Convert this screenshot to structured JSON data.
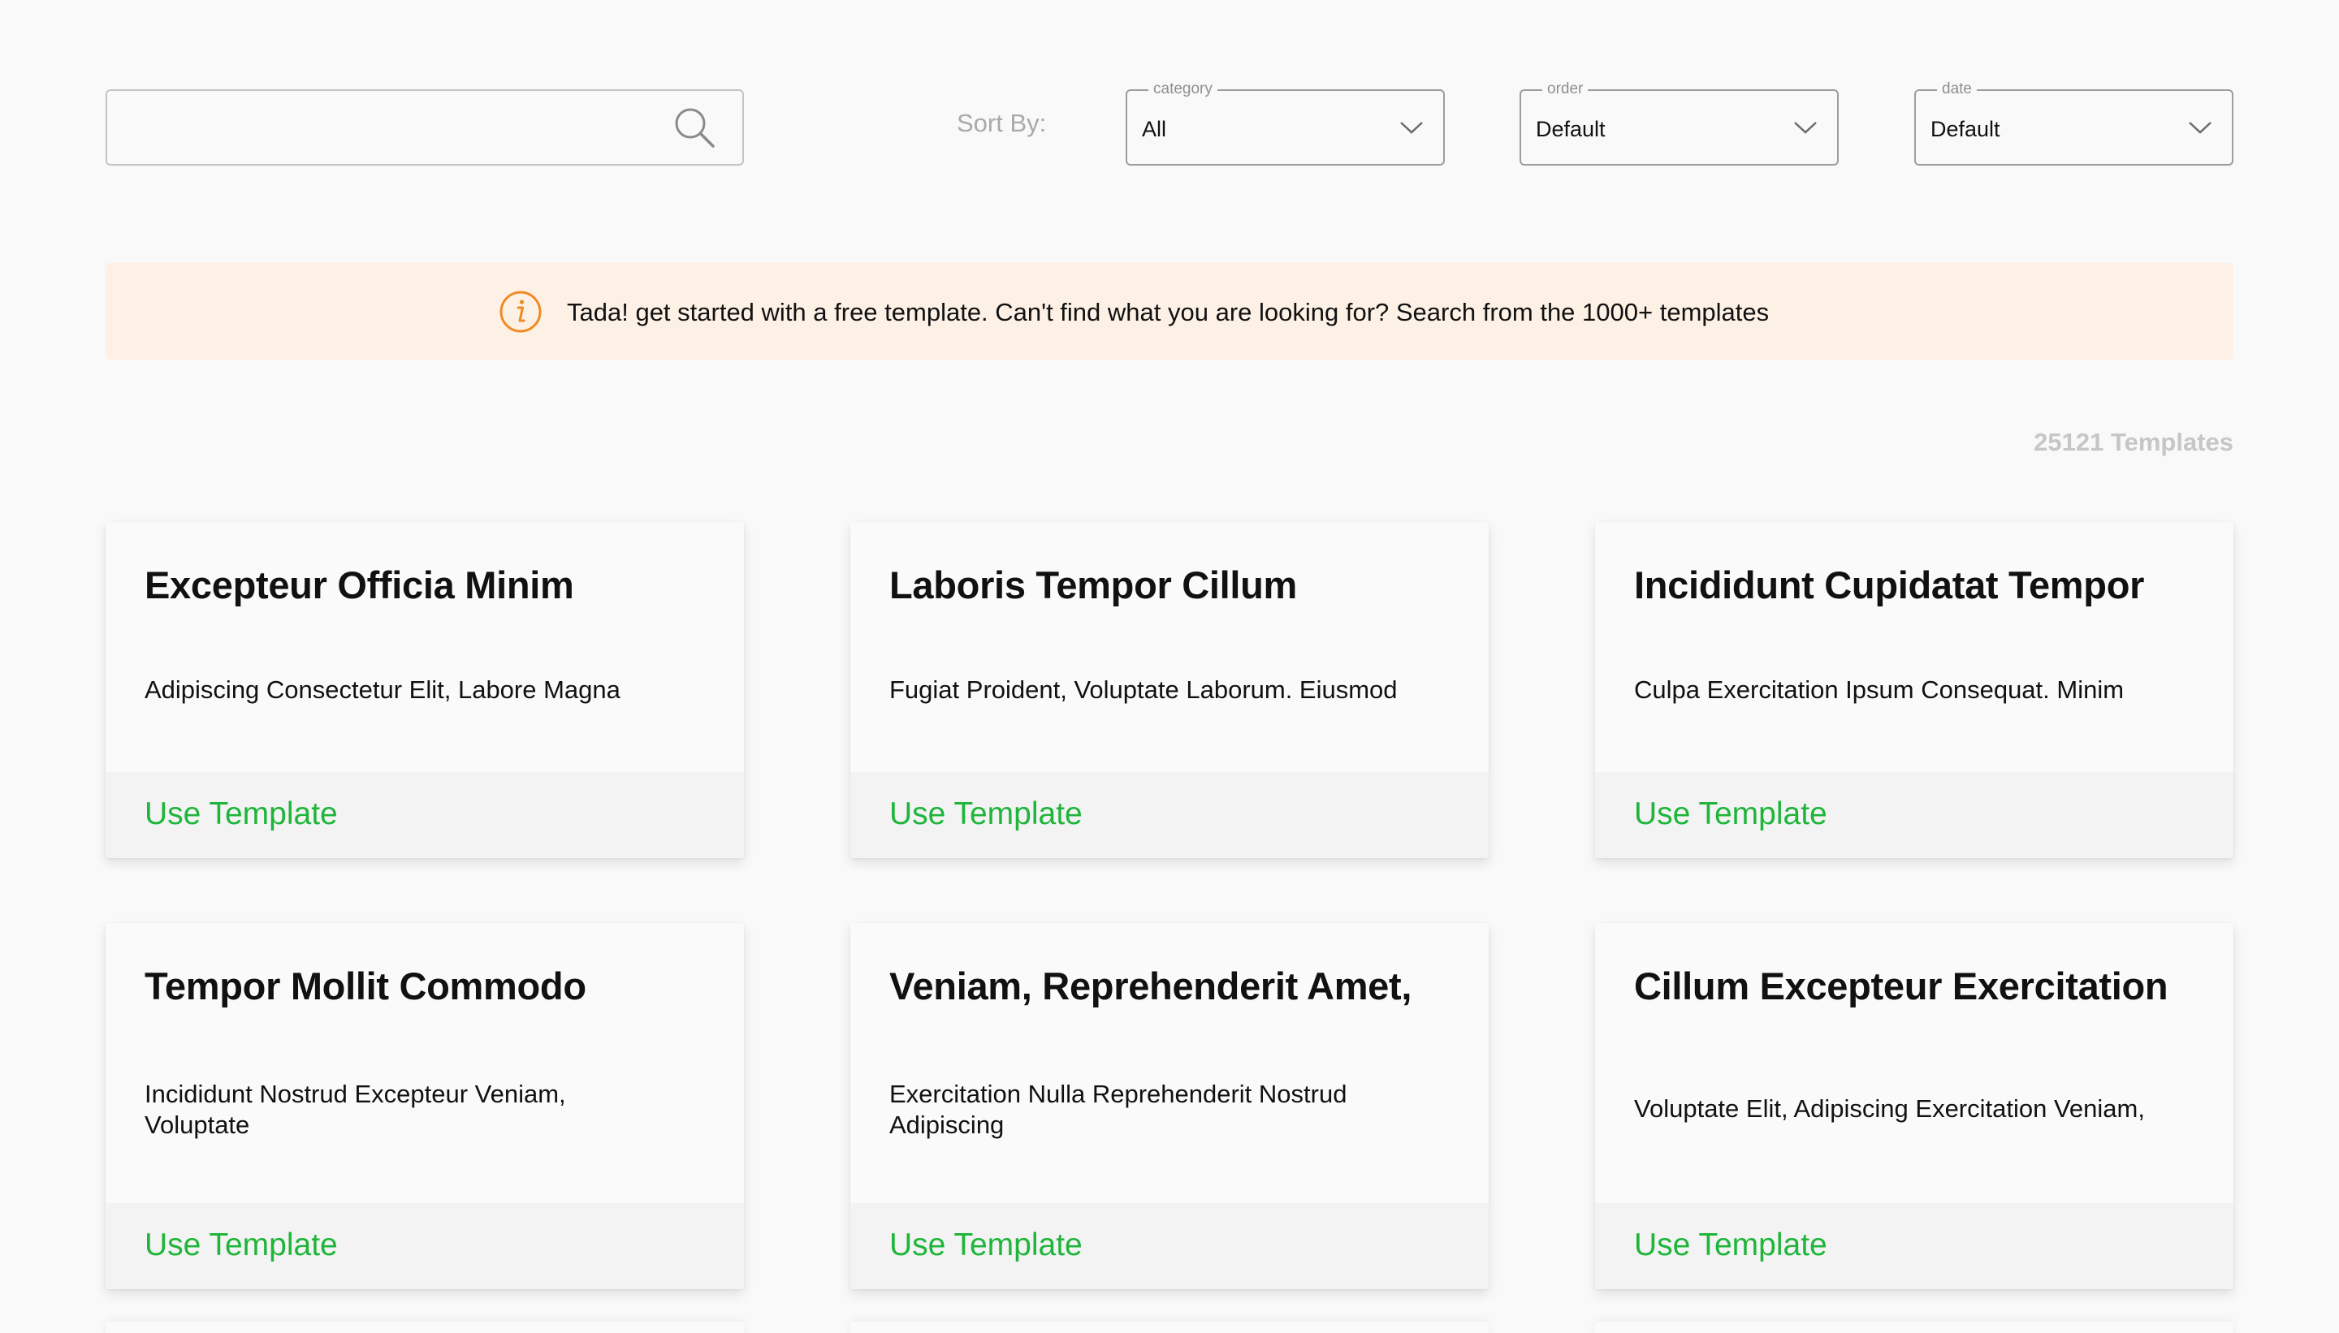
{
  "search": {
    "value": "",
    "placeholder": ""
  },
  "sort": {
    "label": "Sort By:",
    "category": {
      "legend": "category",
      "value": "All"
    },
    "order": {
      "legend": "order",
      "value": "Default"
    },
    "date": {
      "legend": "date",
      "value": "Default"
    }
  },
  "banner": {
    "icon": "info-icon",
    "message": "Tada! get started with a free template. Can't find what you are looking for? Search from the 1000+ templates",
    "background": "#fdf1e6",
    "icon_color": "#f08a24"
  },
  "count": "25121 Templates",
  "accent_color": "#1fb53a",
  "cards": [
    {
      "title": "Excepteur Officia Minim",
      "description": "Adipiscing Consectetur Elit, Labore Magna",
      "action": "Use Template"
    },
    {
      "title": "Laboris Tempor Cillum",
      "description": "Fugiat Proident, Voluptate Laborum. Eiusmod",
      "action": "Use Template"
    },
    {
      "title": "Incididunt Cupidatat Tempor",
      "description": "Culpa Exercitation Ipsum Consequat. Minim",
      "action": "Use Template"
    },
    {
      "title": "Tempor Mollit Commodo",
      "description": "Incididunt Nostrud Excepteur Veniam, Voluptate",
      "action": "Use Template"
    },
    {
      "title": "Veniam, Reprehenderit Amet,",
      "description": "Exercitation Nulla Reprehenderit Nostrud Adipiscing",
      "action": "Use Template"
    },
    {
      "title": "Cillum Excepteur Exercitation",
      "description": "Voluptate Elit, Adipiscing Exercitation Veniam,",
      "action": "Use Template"
    }
  ]
}
